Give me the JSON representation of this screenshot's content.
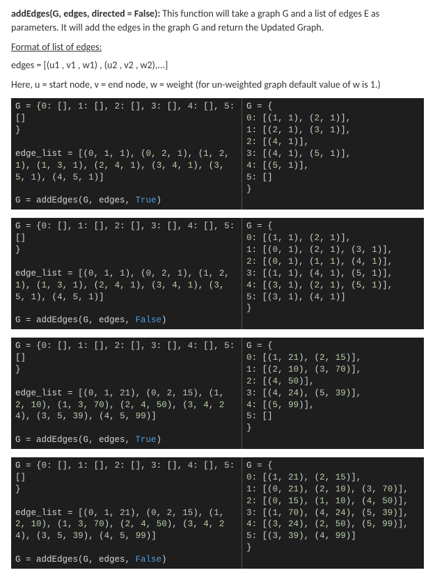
{
  "heading": {
    "fn_signature": "addEdges(G, edges, directed = False):",
    "desc": " This function will take a graph G and a list of edges E as parameters. It will add the edges in the graph G and return the Updated Graph."
  },
  "format_heading": "Format of list of edges:",
  "format_line": "edges = [(u1 , v1 , w1) , (u2 , v2 , w2),...]",
  "explain_line": "Here, u = start node, v = end node, w = weight (for un-weighted graph default value of w is 1.)",
  "examples": [
    {
      "left": {
        "g_init": "G = {0: [], 1: [], 2: [], 3: [], 4: [], 5: []\n}",
        "edge_list": "edge_list = [(0, 1, 1), (0, 2, 1), (1, 2, 1), (1, 3, 1), (2, 4, 1), (3, 4, 1), (3, 5, 1), (4, 5, 1)]",
        "call_pre": "G = addEdges(G, edges, ",
        "call_bool": "True",
        "call_post": ")"
      },
      "right": "G = {\n0: [(1, 1), (2, 1)],\n1: [(2, 1), (3, 1)],\n2: [(4, 1)],\n3: [(4, 1), (5, 1)],\n4: [(5, 1)],\n5: []\n}"
    },
    {
      "left": {
        "g_init": "G = {0: [], 1: [], 2: [], 3: [], 4: [], 5: []\n}",
        "edge_list": "edge_list = [(0, 1, 1), (0, 2, 1), (1, 2, 1), (1, 3, 1), (2, 4, 1), (3, 4, 1), (3, 5, 1), (4, 5, 1)]",
        "call_pre": "G = addEdges(G, edges, ",
        "call_bool": "False",
        "call_post": ")"
      },
      "right": "G = {\n0: [(1, 1), (2, 1)],\n1: [(0, 1), (2, 1), (3, 1)],\n2: [(0, 1), (1, 1), (4, 1)],\n3: [(1, 1), (4, 1), (5, 1)],\n4: [(3, 1), (2, 1), (5, 1)],\n5: [(3, 1), (4, 1)]\n}"
    },
    {
      "left": {
        "g_init": "G = {0: [], 1: [], 2: [], 3: [], 4: [], 5: []\n}",
        "edge_list": "edge_list = [(0, 1, 21), (0, 2, 15), (1, 2, 10), (1, 3, 70), (2, 4, 50), (3, 4, 24), (3, 5, 39), (4, 5, 99)]",
        "call_pre": "G = addEdges(G, edges, ",
        "call_bool": "True",
        "call_post": ")"
      },
      "right": "G = {\n0: [(1, 21), (2, 15)],\n1: [(2, 10), (3, 70)],\n2: [(4, 50)],\n3: [(4, 24), (5, 39)],\n4: [(5, 99)],\n5: []\n}"
    },
    {
      "left": {
        "g_init": "G = {0: [], 1: [], 2: [], 3: [], 4: [], 5: []\n}",
        "edge_list": "edge_list = [(0, 1, 21), (0, 2, 15), (1, 2, 10), (1, 3, 70), (2, 4, 50), (3, 4, 24), (3, 5, 39), (4, 5, 99)]",
        "call_pre": "G = addEdges(G, edges, ",
        "call_bool": "False",
        "call_post": ")"
      },
      "right": "G = {\n0: [(1, 21), (2, 15)],\n1: [(0, 21), (2, 10), (3, 70)],\n2: [(0, 15), (1, 10), (4, 50)],\n3: [(1, 70), (4, 24), (5, 39)],\n4: [(3, 24), (2, 50), (5, 99)],\n5: [(3, 39), (4, 99)]\n}"
    }
  ]
}
